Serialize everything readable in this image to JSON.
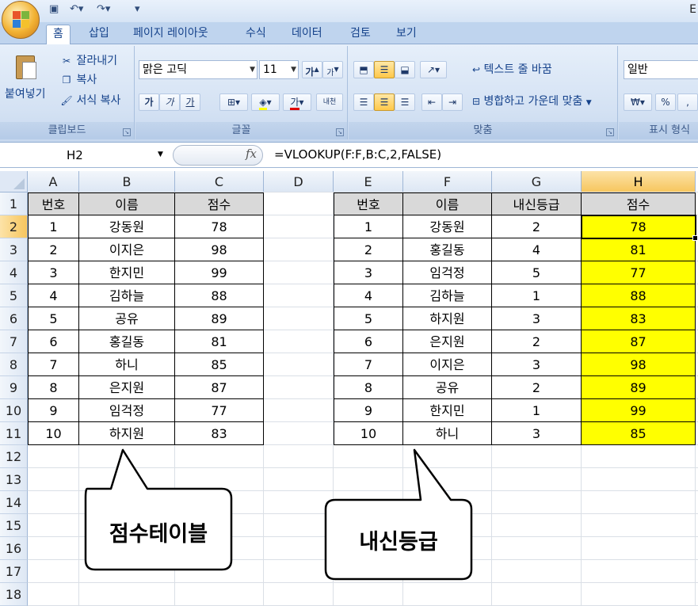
{
  "title_fragment": "E",
  "qat": {
    "save_icon": "save-icon",
    "undo_icon": "undo-icon",
    "redo_icon": "redo-icon",
    "customize": "▾"
  },
  "tabs": [
    "홈",
    "삽입",
    "페이지 레이아웃",
    "수식",
    "데이터",
    "검토",
    "보기"
  ],
  "active_tab": "홈",
  "ribbon": {
    "clipboard": {
      "paste": "붙여넣기",
      "cut": "잘라내기",
      "copy": "복사",
      "format_painter": "서식 복사",
      "title": "클립보드"
    },
    "font": {
      "name": "맑은 고딕",
      "size": "11",
      "grow": "가",
      "shrink": "가",
      "bold": "가",
      "italic": "가",
      "underline": "가",
      "font_color_glyph": "가",
      "phonetic": "내천",
      "title": "글꼴"
    },
    "alignment": {
      "wrap_text": "텍스트 줄 바꿈",
      "merge_center": "병합하고 가운데 맞춤",
      "title": "맞춤"
    },
    "number": {
      "format": "일반",
      "currency": "₩",
      "percent": "%",
      "comma": ",",
      "title": "표시 형식"
    }
  },
  "formula_bar": {
    "name_box": "H2",
    "fx": "fx",
    "formula": "=VLOOKUP(F:F,B:C,2,FALSE)"
  },
  "columns": [
    "A",
    "B",
    "C",
    "D",
    "E",
    "F",
    "G",
    "H"
  ],
  "rows": [
    "1",
    "2",
    "3",
    "4",
    "5",
    "6",
    "7",
    "8",
    "9",
    "10",
    "11",
    "12",
    "13",
    "14",
    "15",
    "16",
    "17",
    "18"
  ],
  "selected_column": "H",
  "selected_row": "2",
  "table1": {
    "headers": [
      "번호",
      "이름",
      "점수"
    ],
    "rows": [
      [
        "1",
        "강동원",
        "78"
      ],
      [
        "2",
        "이지은",
        "98"
      ],
      [
        "3",
        "한지민",
        "99"
      ],
      [
        "4",
        "김하늘",
        "88"
      ],
      [
        "5",
        "공유",
        "89"
      ],
      [
        "6",
        "홍길동",
        "81"
      ],
      [
        "7",
        "하니",
        "85"
      ],
      [
        "8",
        "은지원",
        "87"
      ],
      [
        "9",
        "임걱정",
        "77"
      ],
      [
        "10",
        "하지원",
        "83"
      ]
    ]
  },
  "table2": {
    "headers": [
      "번호",
      "이름",
      "내신등급",
      "점수"
    ],
    "rows": [
      [
        "1",
        "강동원",
        "2",
        "78"
      ],
      [
        "2",
        "홍길동",
        "4",
        "81"
      ],
      [
        "3",
        "임걱정",
        "5",
        "77"
      ],
      [
        "4",
        "김하늘",
        "1",
        "88"
      ],
      [
        "5",
        "하지원",
        "3",
        "83"
      ],
      [
        "6",
        "은지원",
        "2",
        "87"
      ],
      [
        "7",
        "이지은",
        "3",
        "98"
      ],
      [
        "8",
        "공유",
        "2",
        "89"
      ],
      [
        "9",
        "한지민",
        "1",
        "99"
      ],
      [
        "10",
        "하니",
        "3",
        "85"
      ]
    ]
  },
  "callouts": {
    "left": "점수테이블",
    "right": "내신등급"
  },
  "colors": {
    "highlight": "#ffff00",
    "header_fill": "#d9d9d9",
    "selection": "#f7c65e",
    "ribbon": "#d3e1f3"
  }
}
